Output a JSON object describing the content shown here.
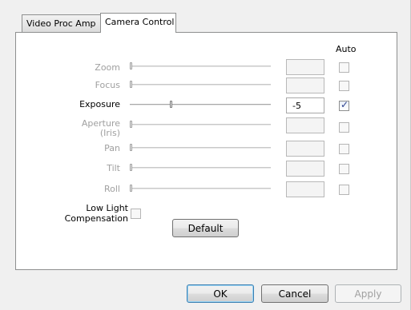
{
  "tabs": [
    {
      "label": "Video Proc Amp",
      "active": false
    },
    {
      "label": "Camera Control",
      "active": true
    }
  ],
  "auto_header": "Auto",
  "controls": [
    {
      "label": "Zoom",
      "value": "",
      "auto": false,
      "enabled": false,
      "level": 0.0
    },
    {
      "label": "Focus",
      "value": "",
      "auto": false,
      "enabled": false,
      "level": 0.0
    },
    {
      "label": "Exposure",
      "value": "-5",
      "auto": true,
      "enabled": true,
      "level": 0.29
    },
    {
      "label": "Aperture\n(Iris)",
      "value": "",
      "auto": false,
      "enabled": false,
      "level": 0.0
    },
    {
      "label": "Pan",
      "value": "",
      "auto": false,
      "enabled": false,
      "level": 0.0
    },
    {
      "label": "Tilt",
      "value": "",
      "auto": false,
      "enabled": false,
      "level": 0.0
    },
    {
      "label": "Roll",
      "value": "",
      "auto": false,
      "enabled": false,
      "level": 0.0
    }
  ],
  "low_light": {
    "label_line1": "Low Light",
    "label_line2": "Compensation",
    "checked": false
  },
  "buttons": {
    "default": "Default",
    "ok": "OK",
    "cancel": "Cancel",
    "apply": "Apply"
  },
  "colors": {
    "check": "#2a3f8e",
    "disabled_text": "#a0a0a0"
  }
}
